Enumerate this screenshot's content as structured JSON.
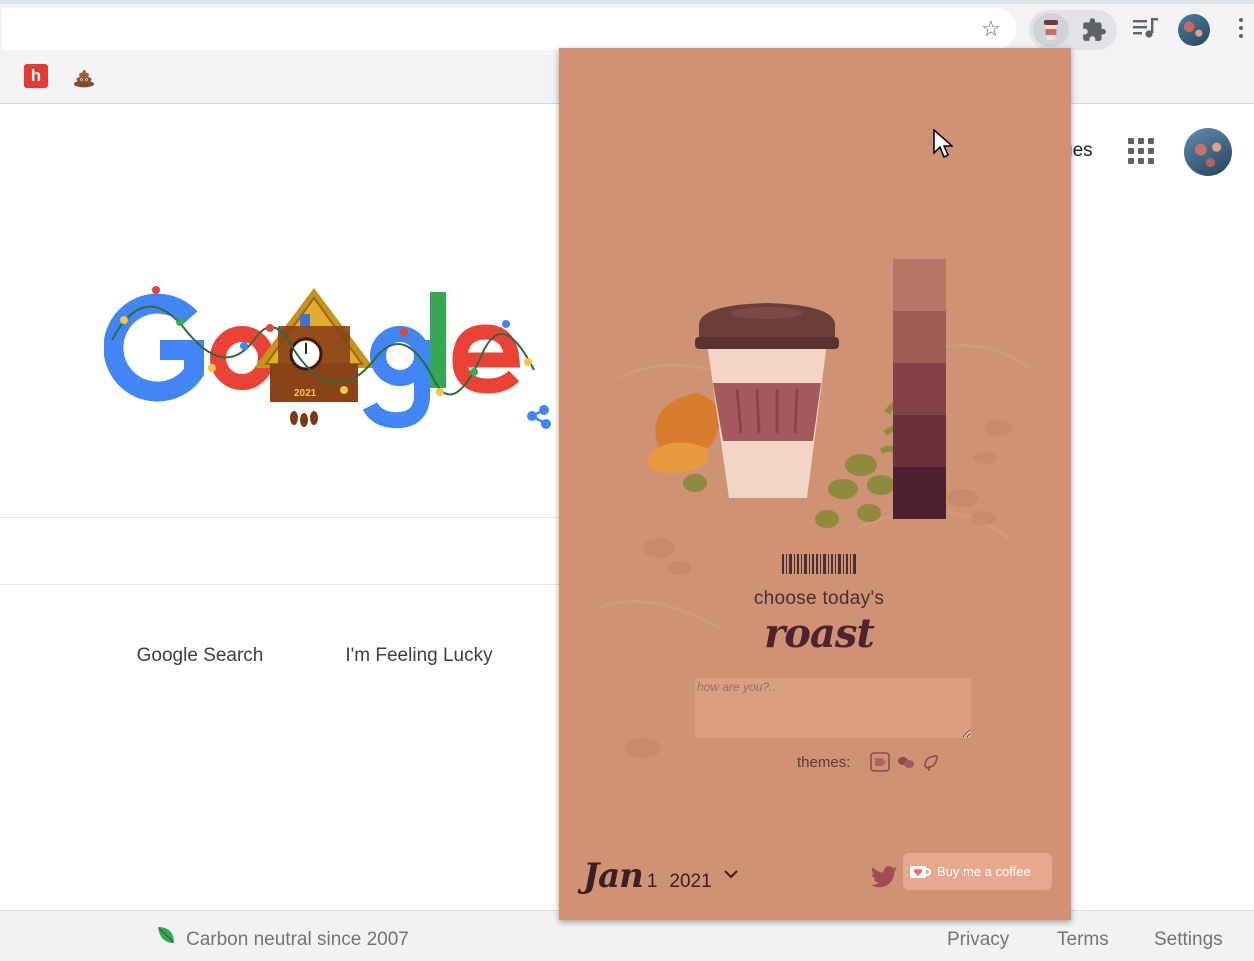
{
  "browser": {
    "toolbar_icons": [
      "bookmark-star-icon",
      "coffee-extension-icon",
      "extensions-puzzle-icon",
      "media-control-icon",
      "profile-avatar",
      "more-menu-icon"
    ],
    "bookmarks": [
      {
        "icon": "h-logo-icon",
        "label": "h"
      },
      {
        "icon": "poo-emoji-icon"
      }
    ]
  },
  "google": {
    "images_link": "ges",
    "search_button": "Google Search",
    "lucky_button": "I'm Feeling Lucky",
    "doodle_year": "2021",
    "footer": {
      "carbon": "Carbon neutral since 2007",
      "privacy": "Privacy",
      "terms": "Terms",
      "settings": "Settings"
    }
  },
  "popup": {
    "bg_color": "#cf9272",
    "palette": [
      "#b77565",
      "#a15b55",
      "#844246",
      "#6a313a",
      "#4e1f2c"
    ],
    "choose_text": "choose today's",
    "roast_text": "roast",
    "mood_placeholder": "how are you?..",
    "themes_label": "themes:",
    "theme_icons": [
      "coffee-cup-theme-icon",
      "coffee-beans-theme-icon",
      "leaf-theme-icon"
    ],
    "date": {
      "month": "Jan",
      "day": "1",
      "year": "2021"
    },
    "buy_coffee": "Buy me a coffee"
  }
}
